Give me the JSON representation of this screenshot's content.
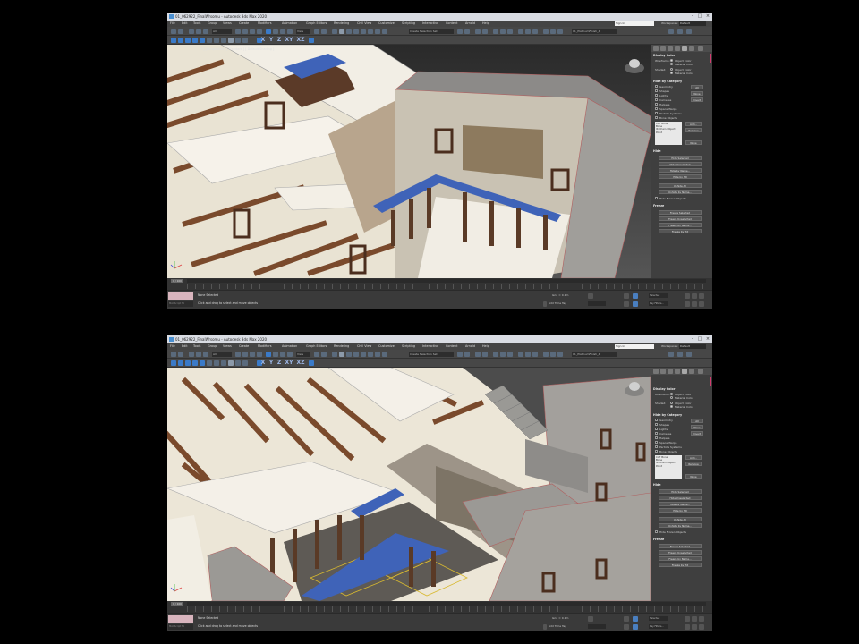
{
  "app": {
    "window_title": "01_062922_FinalWrsomu - Autodesk 3ds Max 2020",
    "search_placeholder": "Sign In",
    "workspaces_label": "Workspaces:",
    "workspaces_value": "Default"
  },
  "menu": [
    "File",
    "Edit",
    "Tools",
    "Group",
    "Views",
    "Create",
    "Modifiers",
    "Animation",
    "Graph Editors",
    "Rendering",
    "Civil View",
    "Customize",
    "Scripting",
    "Interactive",
    "Content",
    "Arnold",
    "Help"
  ],
  "toolbar": {
    "selection_filter": "All",
    "view_dropdown": "View",
    "named_selection": "Create Selection Set",
    "scene_explorer": "01_PlatinumFinish_4",
    "axis_labels": [
      "X",
      "Y",
      "Z",
      "XY",
      "XZ"
    ]
  },
  "viewport": {
    "label": "[+] [Perspective] [ Standard ] [ Default Shading ]"
  },
  "command_panel": {
    "display_color": {
      "title": "Display Color",
      "wireframe_label": "Wireframe:",
      "shaded_label": "Shaded:",
      "object_color": "Object Color",
      "material_color": "Material Color"
    },
    "hide_by_category": {
      "title": "Hide by Category",
      "categories": [
        "Geometry",
        "Shapes",
        "Lights",
        "Cameras",
        "Helpers",
        "Space Warps",
        "Particle Systems",
        "Bone Objects"
      ],
      "buttons": [
        "All",
        "None",
        "Invert"
      ],
      "list_items": [
        "CAT Bone",
        "Bone",
        "IK Chain Object",
        "Point"
      ],
      "list_buttons": [
        "Add...",
        "Remove",
        "None"
      ]
    },
    "hide": {
      "title": "Hide",
      "buttons": [
        "Hide Selected",
        "Hide Unselected",
        "Hide by Name...",
        "Hide by Hit",
        "Unhide All",
        "Unhide by Name...",
        "Hide Frozen Objects"
      ]
    },
    "freeze": {
      "title": "Freeze",
      "buttons": [
        "Freeze Selected",
        "Freeze Unselected",
        "Freeze by Name...",
        "Freeze by Hit"
      ]
    }
  },
  "timeline": {
    "slider_label": "0 / 100"
  },
  "statusbar": {
    "maxscript_placeholder": "MAXScript Mi",
    "prompt": "None Selected",
    "hint": "Click and drag to select and move objects",
    "grid": "Grid = 0.1m",
    "add_time_tag": "Add Time Tag",
    "selected_label": "Selected",
    "key_filters": "Key Filters...",
    "auto_key": "Auto Key",
    "set_key": "Set Key"
  },
  "colors": {
    "accent_blue": "#3a7ac8",
    "panel_bg": "#3f3f3f",
    "viewport_bg": "#4a4a4a",
    "selection_pink": "#d23a6e"
  }
}
